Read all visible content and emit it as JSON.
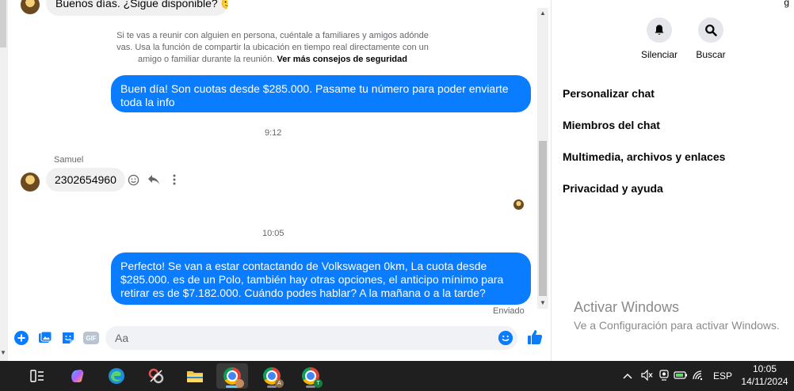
{
  "chat": {
    "previous_message": "Buenos días. ¿Sigue disponible? 🙂",
    "safety_notice": "Si te vas a reunir con alguien en persona, cuéntale a familiares y amigos adónde vas. Usa la función de compartir la ubicación en tiempo real directamente con un amigo o familiar durante la reunión.",
    "safety_link": "Ver más consejos de seguridad",
    "message_out_1": "Buen día! Son cuotas desde $285.000. Pasame tu número para poder enviarte toda la info",
    "time_1": "9:12",
    "sender_name": "Samuel",
    "message_in_1": "2302654960",
    "time_2": "10:05",
    "message_out_2": "Perfecto!  Se van a estar contactando de Volkswagen 0km, La cuota desde $285.000. es de un Polo, también hay otras opciones, el anticipo mínimo para retirar es de $7.182.000. Cuándo podes hablar? A la mañana o a la tarde?",
    "sent_status": "Enviado"
  },
  "composer": {
    "placeholder": "Aa",
    "gif_label": "GIF"
  },
  "right_panel": {
    "top_fragment": "g",
    "mute_label": "Silenciar",
    "search_label": "Buscar",
    "menu": [
      {
        "label": "Personalizar chat"
      },
      {
        "label": "Miembros del chat"
      },
      {
        "label": "Multimedia, archivos y enlaces"
      },
      {
        "label": "Privacidad y ayuda"
      }
    ]
  },
  "watermark": {
    "title": "Activar Windows",
    "subtitle": "Ve a Configuración para activar Windows."
  },
  "taskbar": {
    "language": "ESP",
    "time": "10:05",
    "date": "14/11/2024",
    "chrome_badges": [
      "",
      "A",
      "T"
    ]
  },
  "colors": {
    "accent": "#0a7cff",
    "bubble_in": "#f0f0f0",
    "taskbar": "#1f1f1f"
  }
}
